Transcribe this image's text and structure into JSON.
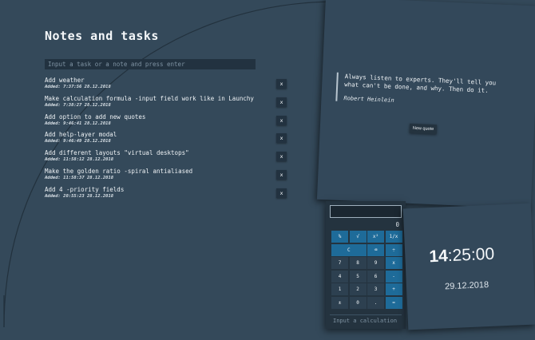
{
  "notes": {
    "title": "Notes and tasks",
    "input_placeholder": "Input a task or a note and press enter",
    "delete_label": "x",
    "tasks": [
      {
        "text": "Add weather",
        "date": "Added: 7:37:56 28.12.2018"
      },
      {
        "text": "Make calculation formula -input field work like in Launchy",
        "date": "Added: 7:38:27 28.12.2018"
      },
      {
        "text": "Add option to add new quotes",
        "date": "Added: 9:46:41 28.12.2018"
      },
      {
        "text": "Add help-layer modal",
        "date": "Added: 9:46:49 28.12.2018"
      },
      {
        "text": "Add different layouts \"virtual desktops\"",
        "date": "Added: 11:58:12 28.12.2018"
      },
      {
        "text": "Make the golden ratio -spiral antialiased",
        "date": "Added: 11:58:37 28.12.2018"
      },
      {
        "text": "Add 4 -priority fields",
        "date": "Added: 20:55:23 28.12.2018"
      }
    ]
  },
  "quote": {
    "text": "Always listen to experts. They'll tell you what can't be done, and why. Then do it.",
    "author": "Robert Heinlein",
    "button_label": "New quote"
  },
  "calculator": {
    "result": "0",
    "input_placeholder": "Input a calculation",
    "keys": [
      {
        "label": "%",
        "name": "calc-key-percent",
        "style": "fn"
      },
      {
        "label": "√",
        "name": "calc-key-sqrt",
        "style": "fn"
      },
      {
        "label": "x²",
        "name": "calc-key-square",
        "style": "fn"
      },
      {
        "label": "1/x",
        "name": "calc-key-reciprocal",
        "style": "fn"
      },
      {
        "label": "C",
        "name": "calc-key-clear",
        "style": "clear"
      },
      {
        "label": "⌫",
        "name": "calc-key-backspace",
        "style": "fn"
      },
      {
        "label": "÷",
        "name": "calc-key-divide",
        "style": "fn"
      },
      {
        "label": "7",
        "name": "calc-key-7",
        "style": ""
      },
      {
        "label": "8",
        "name": "calc-key-8",
        "style": ""
      },
      {
        "label": "9",
        "name": "calc-key-9",
        "style": ""
      },
      {
        "label": "x",
        "name": "calc-key-multiply",
        "style": "fn"
      },
      {
        "label": "4",
        "name": "calc-key-4",
        "style": ""
      },
      {
        "label": "5",
        "name": "calc-key-5",
        "style": ""
      },
      {
        "label": "6",
        "name": "calc-key-6",
        "style": ""
      },
      {
        "label": "-",
        "name": "calc-key-minus",
        "style": "fn"
      },
      {
        "label": "1",
        "name": "calc-key-1",
        "style": ""
      },
      {
        "label": "2",
        "name": "calc-key-2",
        "style": ""
      },
      {
        "label": "3",
        "name": "calc-key-3",
        "style": ""
      },
      {
        "label": "+",
        "name": "calc-key-plus",
        "style": "fn"
      },
      {
        "label": "±",
        "name": "calc-key-negate",
        "style": ""
      },
      {
        "label": "0",
        "name": "calc-key-0",
        "style": ""
      },
      {
        "label": ".",
        "name": "calc-key-decimal",
        "style": ""
      },
      {
        "label": "=",
        "name": "calc-key-equals",
        "style": "fn"
      }
    ]
  },
  "clock": {
    "hours": "14",
    "rest": ":25:00",
    "date": "29.12.2018"
  },
  "colors": {
    "background": "#34495a",
    "panel": "#33485a",
    "dark": "#223240",
    "accent": "#1e6b99"
  }
}
